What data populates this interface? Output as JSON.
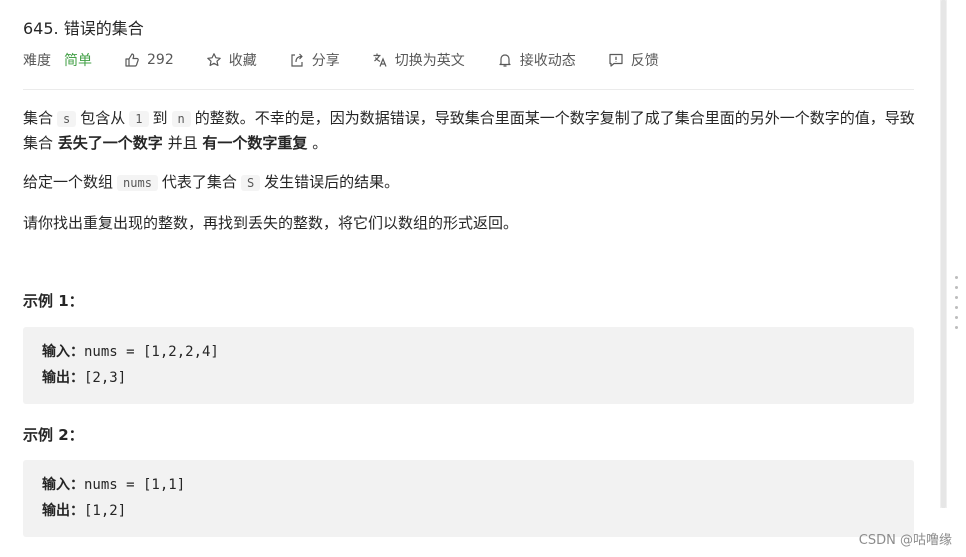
{
  "problem": {
    "title": "645. 错误的集合",
    "difficulty_label": "难度",
    "difficulty": "简单",
    "likes": "292",
    "actions": {
      "favorite": "收藏",
      "share": "分享",
      "switch_lang": "切换为英文",
      "notify": "接收动态",
      "feedback": "反馈"
    }
  },
  "description": {
    "p1": {
      "t1": "集合",
      "c1": "s",
      "t2": "包含从",
      "c2": "1",
      "t3": "到",
      "c3": "n",
      "t4": "的整数。不幸的是，因为数据错误，导致集合里面某一个数字复制了成了集合里面的另外一个数字的值，导致集合",
      "b1": "丢失了一个数字",
      "t5": "并且",
      "b2": "有一个数字重复",
      "t6": "。"
    },
    "p2": {
      "t1": "给定一个数组",
      "c1": "nums",
      "t2": "代表了集合",
      "c2": "S",
      "t3": "发生错误后的结果。"
    },
    "p3": "请你找出重复出现的整数，再找到丢失的整数，将它们以数组的形式返回。"
  },
  "examples": [
    {
      "title": "示例 1：",
      "input_label": "输入：",
      "input": "nums = [1,2,2,4]",
      "output_label": "输出：",
      "output": "[2,3]"
    },
    {
      "title": "示例 2：",
      "input_label": "输入：",
      "input": "nums = [1,1]",
      "output_label": "输出：",
      "output": "[1,2]"
    }
  ],
  "watermark": "CSDN @咕噜缘",
  "colors": {
    "difficulty_easy": "#43a047",
    "code_bg": "#f4f4f4",
    "example_bg": "#f2f2f2"
  }
}
